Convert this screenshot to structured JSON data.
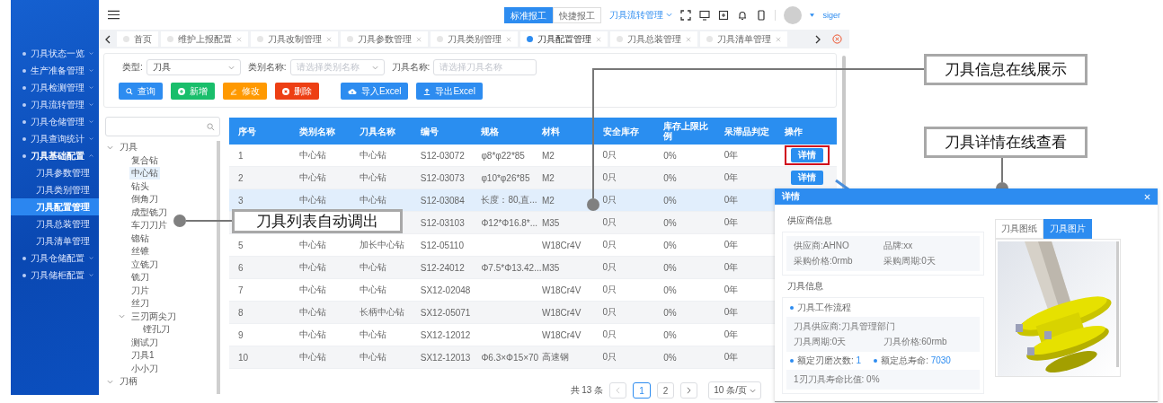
{
  "sidebar": {
    "items": [
      {
        "label": "刀具状态一览",
        "expanded": false
      },
      {
        "label": "生产准备管理",
        "expanded": false
      },
      {
        "label": "刀具检测管理",
        "expanded": false
      },
      {
        "label": "刀具流转管理",
        "expanded": false
      },
      {
        "label": "刀具仓储管理",
        "expanded": false
      },
      {
        "label": "刀具查询统计",
        "expanded": false
      },
      {
        "label": "刀具基础配置",
        "expanded": true,
        "children": [
          {
            "label": "刀具参数管理",
            "selected": false
          },
          {
            "label": "刀具类别管理",
            "selected": false
          },
          {
            "label": "刀具配置管理",
            "selected": true
          },
          {
            "label": "刀具总装管理",
            "selected": false
          },
          {
            "label": "刀具清单管理",
            "selected": false
          }
        ]
      },
      {
        "label": "刀具仓储配置",
        "expanded": false
      },
      {
        "label": "刀具储柜配置",
        "expanded": false
      }
    ]
  },
  "header": {
    "report_modes": [
      {
        "label": "标准报工",
        "selected": true
      },
      {
        "label": "快捷报工",
        "selected": false
      }
    ],
    "menu": "刀具流转管理",
    "user": "siger"
  },
  "tabs": [
    {
      "label": "首页",
      "selected": false,
      "closable": false
    },
    {
      "label": "维护上报配置",
      "selected": false,
      "closable": true
    },
    {
      "label": "刀具改制管理",
      "selected": false,
      "closable": true
    },
    {
      "label": "刀具参数管理",
      "selected": false,
      "closable": true
    },
    {
      "label": "刀具类别管理",
      "selected": false,
      "closable": true
    },
    {
      "label": "刀具配置管理",
      "selected": true,
      "closable": true
    },
    {
      "label": "刀具总装管理",
      "selected": false,
      "closable": true
    },
    {
      "label": "刀具清单管理",
      "selected": false,
      "closable": true
    }
  ],
  "filters": [
    {
      "label": "类型:",
      "kind": "select",
      "value": "刀具"
    },
    {
      "label": "类别名称:",
      "kind": "select",
      "placeholder": "请选择类别名称"
    },
    {
      "label": "刀具名称:",
      "kind": "input",
      "placeholder": "请选择刀具名称"
    }
  ],
  "buttons": [
    {
      "label": "查询",
      "kind": "search",
      "color": "#2d8cf0"
    },
    {
      "label": "新增",
      "kind": "add",
      "color": "#19be6b"
    },
    {
      "label": "修改",
      "kind": "edit",
      "color": "#ff9900"
    },
    {
      "label": "删除",
      "kind": "delete",
      "color": "#ed3f14"
    },
    {
      "label": "导入Excel",
      "kind": "import",
      "color": "#2d8cf0"
    },
    {
      "label": "导出Excel",
      "kind": "export",
      "color": "#2d8cf0"
    }
  ],
  "tree": {
    "items": [
      {
        "label": "刀具",
        "selected": false,
        "expanded": true,
        "children": [
          {
            "label": "复合钻",
            "selected": false
          },
          {
            "label": "中心钻",
            "selected": true
          },
          {
            "label": "钻头",
            "selected": false
          },
          {
            "label": "倒角刀",
            "selected": false
          },
          {
            "label": "成型铣刀",
            "selected": false
          },
          {
            "label": "车刀刀片",
            "selected": false
          },
          {
            "label": "锪钻",
            "selected": false
          },
          {
            "label": "丝锥",
            "selected": false
          },
          {
            "label": "立铣刀",
            "selected": false
          },
          {
            "label": "铣刀",
            "selected": false
          },
          {
            "label": "刀片",
            "selected": false
          },
          {
            "label": "丝刀",
            "selected": false
          },
          {
            "label": "三刃两尖刀",
            "selected": false,
            "expanded": true,
            "children": [
              {
                "label": "镗孔刀",
                "selected": false
              }
            ]
          },
          {
            "label": "测试刀",
            "selected": false
          },
          {
            "label": "刀具1",
            "selected": false
          },
          {
            "label": "小小刀",
            "selected": false
          }
        ]
      },
      {
        "label": "刀柄",
        "selected": false,
        "expanded": true
      }
    ]
  },
  "table": {
    "columns": [
      "序号",
      "类别名称",
      "刀具名称",
      "编号",
      "规格",
      "材料",
      "安全库存",
      "库存上限比例",
      "呆滞品判定",
      "操作"
    ],
    "rows": [
      {
        "cells": [
          "1",
          "中心钻",
          "中心钻",
          "S12-03072",
          "φ8*φ22*85",
          "M2",
          "0只",
          "0%",
          "0年"
        ],
        "action": "详情",
        "marked": true,
        "highlighted": false
      },
      {
        "cells": [
          "2",
          "中心钻",
          "中心钻",
          "S12-03073",
          "φ10*φ26*85",
          "M2",
          "0只",
          "0%",
          "0年"
        ],
        "action": "详情",
        "marked": false,
        "highlighted": false
      },
      {
        "cells": [
          "3",
          "中心钻",
          "中心钻",
          "S12-03084",
          "长度：80,直...",
          "M2",
          "0只",
          "0%",
          "0年"
        ],
        "highlighted": true
      },
      {
        "cells": [
          null,
          null,
          null,
          "S12-03103",
          "Φ12*Φ16.8*...",
          "M35",
          "0只",
          "0%",
          "0年"
        ],
        "highlighted": false
      },
      {
        "cells": [
          "5",
          "中心钻",
          "加长中心钻",
          "S12-05110",
          null,
          "W18Cr4V",
          "0只",
          "0%",
          "0年"
        ],
        "highlighted": false
      },
      {
        "cells": [
          "6",
          "中心钻",
          "中心钻",
          "S12-24012",
          "Φ7.5*Φ13.42...",
          "M35",
          "0只",
          "0%",
          "0年"
        ],
        "highlighted": false
      },
      {
        "cells": [
          "7",
          "中心钻",
          "中心钻",
          "SX12-02048",
          null,
          "W18Cr4V",
          "0只",
          "0%",
          "0年"
        ],
        "highlighted": false
      },
      {
        "cells": [
          "8",
          "中心钻",
          "长柄中心钻",
          "SX12-05071",
          null,
          "W18Cr4V",
          "0只",
          "0%",
          "0年"
        ],
        "highlighted": false
      },
      {
        "cells": [
          "9",
          "中心钻",
          "中心钻",
          "SX12-12012",
          null,
          "W18Cr4V",
          "0只",
          "0%",
          "0年"
        ],
        "highlighted": false
      },
      {
        "cells": [
          "10",
          "中心钻",
          "中心钻",
          "SX12-12013",
          "Φ6.3×Φ15×70",
          "高速钢",
          "0只",
          "0%",
          "0年"
        ],
        "highlighted": false
      }
    ]
  },
  "pagination": {
    "total": "共 13 条",
    "pages": [
      {
        "label": "1",
        "selected": true
      },
      {
        "label": "2",
        "selected": false
      }
    ],
    "page_size": "10 条/页"
  },
  "detail_dialog": {
    "title": "详情",
    "supplier": {
      "heading": "供应商信息",
      "fields": [
        "供应商:AHNO",
        "品牌:xx",
        "采购价格:0rmb",
        "采购周期:0天"
      ]
    },
    "tool": {
      "heading": "刀具信息",
      "workflow": "刀具工作流程",
      "fields": [
        "刀具供应商:刀具管理部门",
        "刀具周期:0天",
        "刀具价格:60rmb"
      ],
      "ratings": [
        {
          "label": "额定刃磨次数:",
          "value": "1"
        },
        {
          "label": "额定总寿命:",
          "value": "7030"
        }
      ],
      "ratio": "1刃刀具寿命比值: 0%"
    },
    "image_tabs": [
      {
        "label": "刀具图纸",
        "selected": false
      },
      {
        "label": "刀具图片",
        "selected": true
      }
    ]
  },
  "callouts": [
    {
      "text": "刀具信息在线展示"
    },
    {
      "text": "刀具详情在线查看"
    },
    {
      "text": "刀具列表自动调出"
    }
  ]
}
